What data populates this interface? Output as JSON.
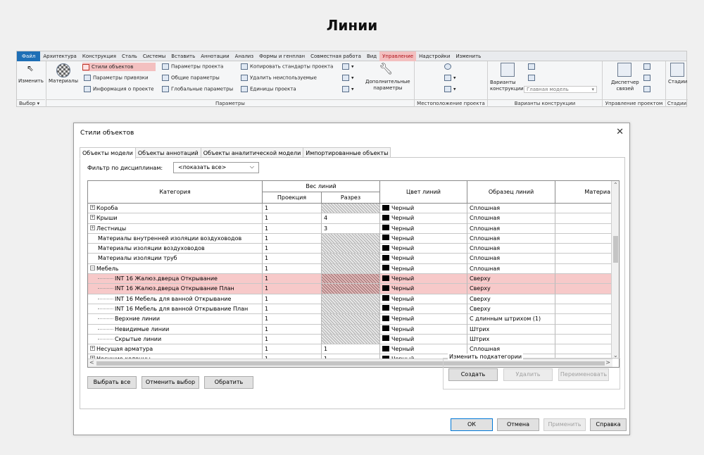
{
  "page_title": "Линии",
  "menubar": [
    "Файл",
    "Архитектура",
    "Конструкция",
    "Сталь",
    "Системы",
    "Вставить",
    "Аннотации",
    "Анализ",
    "Формы и генплан",
    "Совместная работа",
    "Вид",
    "Управление",
    "Надстройки",
    "Изменить"
  ],
  "ribbon": {
    "modify": "Изменить",
    "materials": "Материалы",
    "object_styles": "Стили объектов",
    "snap_params": "Параметры привязки",
    "project_info": "Информация о проекте",
    "project_params": "Параметры проекта",
    "shared_params": "Общие параметры",
    "global_params": "Глобальные параметры",
    "transfer_standards": "Копировать стандарты проекта",
    "purge_unused": "Удалить неиспользуемые",
    "project_units": "Единицы проекта",
    "additional_settings_line1": "Дополнительные",
    "additional_settings_line2": "параметры",
    "design_options_line1": "Варианты",
    "design_options_line2": "конструкции",
    "main_model": "Главная модель",
    "manage_links_line1": "Диспетчер",
    "manage_links_line2": "связей",
    "phases": "Стадии",
    "panel_select": "Выбор ▾",
    "panel_settings": "Параметры",
    "panel_location": "Местоположение проекта",
    "panel_design_options": "Варианты конструкции",
    "panel_manage_project": "Управление проектом",
    "panel_phases": "Стадии"
  },
  "dialog": {
    "title": "Стили объектов",
    "tabs": [
      "Объекты модели",
      "Объекты аннотаций",
      "Объекты аналитической модели",
      "Импортированные объекты"
    ],
    "filter_label": "Фильтр по дисциплинам:",
    "filter_value": "<показать все>",
    "headers": {
      "category": "Категория",
      "line_weight": "Вес линий",
      "projection": "Проекция",
      "cut": "Разрез",
      "line_color": "Цвет линий",
      "line_pattern": "Образец линий",
      "material": "Материа"
    },
    "rows": [
      {
        "name": "Короба",
        "expander": "+",
        "proj": "1",
        "cut": "",
        "hatch": true,
        "color": "Черный",
        "pattern": "Сплошная",
        "level": 0,
        "selected": false
      },
      {
        "name": "Крыши",
        "expander": "+",
        "proj": "1",
        "cut": "4",
        "hatch": false,
        "color": "Черный",
        "pattern": "Сплошная",
        "level": 0,
        "selected": false
      },
      {
        "name": "Лестницы",
        "expander": "+",
        "proj": "1",
        "cut": "3",
        "hatch": false,
        "color": "Черный",
        "pattern": "Сплошная",
        "level": 0,
        "selected": false
      },
      {
        "name": "Материалы внутренней изоляции воздуховодов",
        "expander": "",
        "proj": "1",
        "cut": "",
        "hatch": true,
        "color": "Черный",
        "pattern": "Сплошная",
        "level": 0,
        "selected": false
      },
      {
        "name": "Материалы изоляции воздуховодов",
        "expander": "",
        "proj": "1",
        "cut": "",
        "hatch": true,
        "color": "Черный",
        "pattern": "Сплошная",
        "level": 0,
        "selected": false
      },
      {
        "name": "Материалы изоляции труб",
        "expander": "",
        "proj": "1",
        "cut": "",
        "hatch": true,
        "color": "Черный",
        "pattern": "Сплошная",
        "level": 0,
        "selected": false
      },
      {
        "name": "Мебель",
        "expander": "−",
        "proj": "1",
        "cut": "",
        "hatch": true,
        "color": "Черный",
        "pattern": "Сплошная",
        "level": 0,
        "selected": false
      },
      {
        "name": "INT 16 Жалюз.дверца Открывание",
        "expander": "",
        "proj": "1",
        "cut": "",
        "hatch": true,
        "color": "Черный",
        "pattern": "Сверху",
        "level": 1,
        "selected": true
      },
      {
        "name": "INT 16 Жалюз.дверца Открывание План",
        "expander": "",
        "proj": "1",
        "cut": "",
        "hatch": true,
        "color": "Черный",
        "pattern": "Сверху",
        "level": 1,
        "selected": true
      },
      {
        "name": "INT 16 Мебель для ванной Открывание",
        "expander": "",
        "proj": "1",
        "cut": "",
        "hatch": true,
        "color": "Черный",
        "pattern": "Сверху",
        "level": 1,
        "selected": false
      },
      {
        "name": "INT 16 Мебель для ванной Открывание План",
        "expander": "",
        "proj": "1",
        "cut": "",
        "hatch": true,
        "color": "Черный",
        "pattern": "Сверху",
        "level": 1,
        "selected": false
      },
      {
        "name": "Верхние линии",
        "expander": "",
        "proj": "1",
        "cut": "",
        "hatch": true,
        "color": "Черный",
        "pattern": "С длинным штрихом (1)",
        "level": 1,
        "selected": false
      },
      {
        "name": "Невидимые линии",
        "expander": "",
        "proj": "1",
        "cut": "",
        "hatch": true,
        "color": "Черный",
        "pattern": "Штрих",
        "level": 1,
        "selected": false
      },
      {
        "name": "Скрытые линии",
        "expander": "",
        "proj": "1",
        "cut": "",
        "hatch": true,
        "color": "Черный",
        "pattern": "Штрих",
        "level": 1,
        "selected": false
      },
      {
        "name": "Несущая арматура",
        "expander": "+",
        "proj": "1",
        "cut": "1",
        "hatch": false,
        "color": "Черный",
        "pattern": "Сплошная",
        "level": 0,
        "selected": false
      },
      {
        "name": "Несущие колонны",
        "expander": "+",
        "proj": "1",
        "cut": "1",
        "hatch": false,
        "color": "Черный",
        "pattern": "Сплошная",
        "level": 0,
        "selected": false
      }
    ],
    "buttons": {
      "select_all": "Выбрать все",
      "select_none": "Отменить выбор",
      "invert": "Обратить",
      "modify_subcategories": "Изменить подкатегории",
      "create": "Создать",
      "delete": "Удалить",
      "rename": "Переименовать",
      "ok": "ОК",
      "cancel": "Отмена",
      "apply": "Применить",
      "help": "Справка"
    }
  }
}
